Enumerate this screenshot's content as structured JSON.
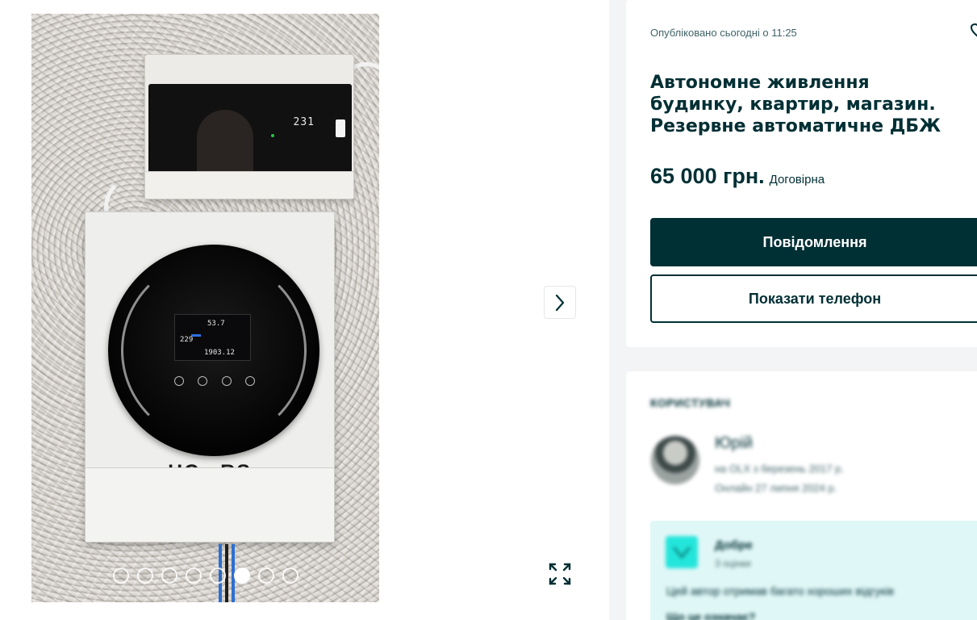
{
  "gallery": {
    "photo": {
      "breaker_display": "231",
      "lcd_line1": "53.7",
      "lcd_line2": "229",
      "lcd_line3": "1903.12",
      "brand_left": "HC",
      "brand_right": "RS"
    },
    "image_count": 8,
    "active_image_index": 6,
    "icons": {
      "next": "chevron-right-icon",
      "expand": "fullscreen-icon"
    }
  },
  "ad": {
    "posted": "Опубліковано сьогодні о 11:25",
    "title": "Автономне живлення будинку, квартир, магазин. Резервне автоматичне ДБЖ",
    "price": "65 000 грн.",
    "negotiable": "Договірна",
    "message_button": "Повідомлення",
    "phone_button": "Показати телефон"
  },
  "user": {
    "heading": "КОРИСТУВАЧ",
    "name": "Юрій",
    "on_olx_since": "на OLX з березень 2017 р.",
    "last_online": "Онлайн 27 липня 2024 р.",
    "rating": {
      "title": "Добре",
      "subtitle": "3 оцінки",
      "description": "Цей автор отримав багато хороших відгуків",
      "more": "Що це означає?"
    }
  },
  "colors": {
    "brand_dark": "#002f34",
    "secondary_text": "#406367",
    "rating_bg": "#e0f7f7",
    "rating_accent": "#23e5db",
    "page_bg": "#f2f4f5"
  }
}
